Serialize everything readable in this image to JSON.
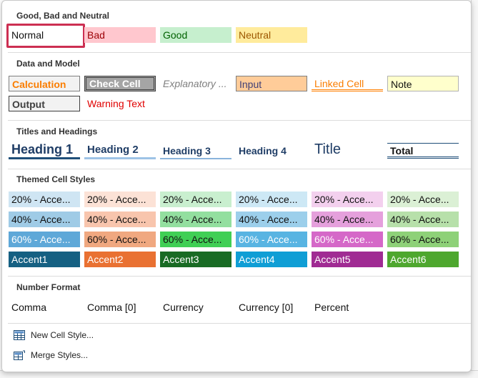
{
  "sections": {
    "good_bad_neutral": "Good, Bad and Neutral",
    "data_model": "Data and Model",
    "titles_headings": "Titles and Headings",
    "themed": "Themed Cell Styles",
    "number_format": "Number Format"
  },
  "good_bad_neutral": [
    "Normal",
    "Bad",
    "Good",
    "Neutral"
  ],
  "data_model_row1": [
    "Calculation",
    "Check Cell",
    "Explanatory ...",
    "Input",
    "Linked Cell",
    "Note"
  ],
  "data_model_row2": [
    "Output",
    "Warning Text"
  ],
  "titles": [
    "Heading 1",
    "Heading 2",
    "Heading 3",
    "Heading 4",
    "Title",
    "Total"
  ],
  "themed": {
    "row20": [
      "20% - Acce...",
      "20% - Acce...",
      "20% - Acce...",
      "20% - Acce...",
      "20% - Acce...",
      "20% - Acce..."
    ],
    "row40": [
      "40% - Acce...",
      "40% - Acce...",
      "40% - Acce...",
      "40% - Acce...",
      "40% - Acce...",
      "40% - Acce..."
    ],
    "row60": [
      "60% - Acce...",
      "60% - Acce...",
      "60% - Acce...",
      "60% - Acce...",
      "60% - Acce...",
      "60% - Acce..."
    ],
    "accents": [
      "Accent1",
      "Accent2",
      "Accent3",
      "Accent4",
      "Accent5",
      "Accent6"
    ]
  },
  "number_format": [
    "Comma",
    "Comma [0]",
    "Currency",
    "Currency [0]",
    "Percent"
  ],
  "menu": {
    "new_style": "New Cell Style...",
    "merge_styles": "Merge Styles..."
  },
  "colors": {
    "selection": "#cc2f52",
    "bad_bg": "#ffc7ce",
    "bad_fg": "#9c0006",
    "good_bg": "#c6efce",
    "good_fg": "#006100",
    "neutral_bg": "#ffeb9c",
    "neutral_fg": "#9c5700"
  },
  "icons": {
    "new_style": "cell-style-icon",
    "merge_styles": "merge-styles-icon"
  }
}
